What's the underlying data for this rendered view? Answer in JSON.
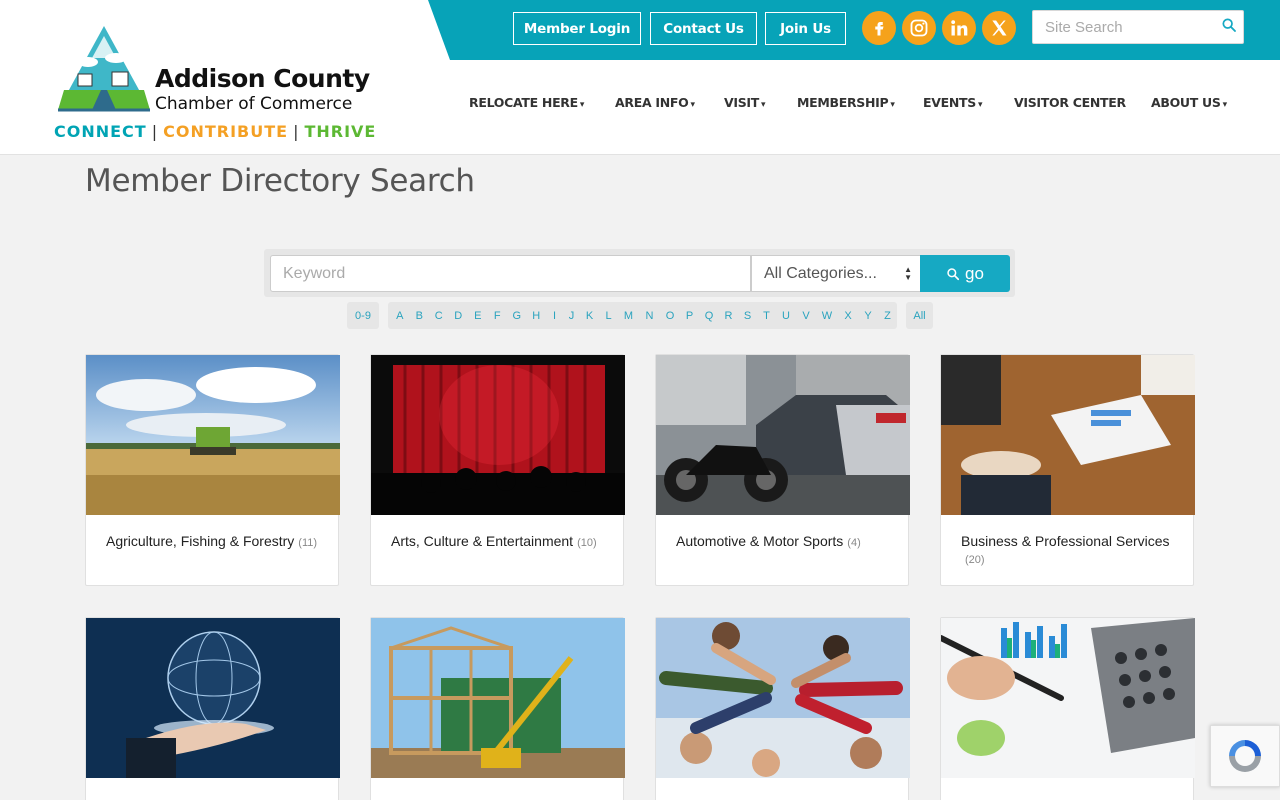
{
  "logo": {
    "name": "Addison County",
    "subtitle": "Chamber of Commerce",
    "tag_connect": "CONNECT",
    "tag_contribute": "CONTRIBUTE",
    "tag_thrive": "THRIVE",
    "tag_sep": "|"
  },
  "topbar": {
    "buttons": [
      "Member Login",
      "Contact Us",
      "Join Us"
    ],
    "social": [
      "facebook-icon",
      "instagram-icon",
      "linkedin-icon",
      "x-icon"
    ],
    "search_placeholder": "Site Search"
  },
  "nav": [
    {
      "label": "RELOCATE HERE",
      "dropdown": true
    },
    {
      "label": "AREA INFO",
      "dropdown": true
    },
    {
      "label": "VISIT",
      "dropdown": true
    },
    {
      "label": "MEMBERSHIP",
      "dropdown": true
    },
    {
      "label": "EVENTS",
      "dropdown": true
    },
    {
      "label": "VISITOR CENTER",
      "dropdown": false
    },
    {
      "label": "ABOUT US",
      "dropdown": true
    }
  ],
  "page": {
    "title": "Member Directory Search"
  },
  "search": {
    "keyword_placeholder": "Keyword",
    "category_value": "All Categories...",
    "go_label": "go"
  },
  "alpha": {
    "digits": "0-9",
    "letters": [
      "A",
      "B",
      "C",
      "D",
      "E",
      "F",
      "G",
      "H",
      "I",
      "J",
      "K",
      "L",
      "M",
      "N",
      "O",
      "P",
      "Q",
      "R",
      "S",
      "T",
      "U",
      "V",
      "W",
      "X",
      "Y",
      "Z"
    ],
    "all": "All"
  },
  "categories": [
    {
      "name": "Agriculture, Fishing & Forestry",
      "count": "(11)"
    },
    {
      "name": "Arts, Culture & Entertainment",
      "count": "(10)"
    },
    {
      "name": "Automotive & Motor Sports",
      "count": "(4)"
    },
    {
      "name": "Business & Professional Services",
      "count": "(20)"
    },
    {
      "name": "",
      "count": ""
    },
    {
      "name": "",
      "count": ""
    },
    {
      "name": "",
      "count": ""
    },
    {
      "name": "",
      "count": ""
    }
  ],
  "colors": {
    "teal": "#07a3b8",
    "orange": "#f5a21b",
    "button_blue": "#16a9c3",
    "link": "#2aa3be"
  }
}
